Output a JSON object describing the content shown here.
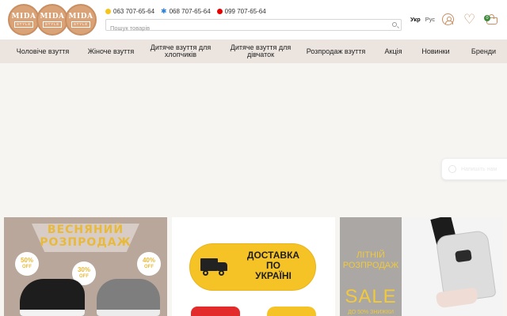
{
  "header": {
    "logo": [
      "MIDA",
      "MIDA",
      "MIDA"
    ],
    "logo_sub": [
      "STYLE",
      "STYLE",
      "STYLE"
    ],
    "phones": [
      {
        "operator": "lifecell",
        "number": "063 707-65-64"
      },
      {
        "operator": "kyivstar",
        "number": "068 707-65-64"
      },
      {
        "operator": "vodafone",
        "number": "099 707-65-64"
      }
    ],
    "search_placeholder": "Пошук товарів",
    "lang_active": "Укр",
    "lang_other": "Рус",
    "cart_count": "0"
  },
  "nav": [
    "Чоловіче взуття",
    "Жіноче взуття",
    "Дитяче взуття для хлопчиків",
    "Дитяче взуття для дівчаток",
    "Розпродаж взуття",
    "Акція",
    "Новинки",
    "Бренди"
  ],
  "chat": {
    "label": "Напишіть нам"
  },
  "banners": {
    "spring_sale": {
      "title_line1": "ВЕСНЯНИЙ",
      "title_line2": "РОЗПРОДАЖ",
      "badges": [
        {
          "pct": "50%",
          "off": "OFF"
        },
        {
          "pct": "30%",
          "off": "OFF"
        },
        {
          "pct": "40%",
          "off": "OFF"
        }
      ]
    },
    "delivery": {
      "line1": "ДОСТАВКА",
      "line2": "ПО",
      "line3": "УКРАЇНІ"
    },
    "summer_sale": {
      "line1": "ЛІТНІЙ",
      "line2": "РОЗПРОДАЖ",
      "sale": "SALE",
      "sub": "ДО 50% ЗНИЖКИ"
    }
  },
  "colors": {
    "brand_tan": "#d9a277",
    "nav_bg": "#ece5df",
    "accent_yellow": "#f6c327",
    "cart_badge": "#3d8b3d"
  }
}
